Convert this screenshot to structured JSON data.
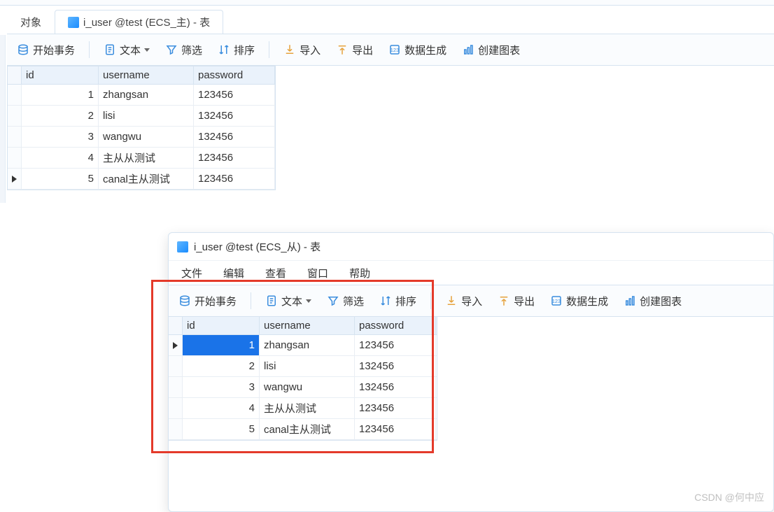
{
  "tabs": {
    "obj_label": "对象",
    "main_label": "i_user @test (ECS_主) - 表"
  },
  "toolbar": {
    "begin_tx": "开始事务",
    "text": "文本",
    "filter": "筛选",
    "sort": "排序",
    "import": "导入",
    "export": "导出",
    "data_gen": "数据生成",
    "chart": "创建图表"
  },
  "grid": {
    "headers": {
      "id": "id",
      "username": "username",
      "password": "password"
    },
    "rows": [
      {
        "id": "1",
        "username": "zhangsan",
        "password": "123456"
      },
      {
        "id": "2",
        "username": "lisi",
        "password": "132456"
      },
      {
        "id": "3",
        "username": "wangwu",
        "password": "132456"
      },
      {
        "id": "4",
        "username": "主从从测试",
        "password": "123456"
      },
      {
        "id": "5",
        "username": "canal主从测试",
        "password": "123456"
      }
    ],
    "cursor_row": 4
  },
  "win2": {
    "title": "i_user @test (ECS_从) - 表",
    "menu": {
      "file": "文件",
      "edit": "编辑",
      "view": "查看",
      "window": "窗口",
      "help": "帮助"
    },
    "cursor_row": 0,
    "selected_cell": {
      "row": 0,
      "col": "id"
    }
  },
  "watermark": "CSDN @何中应"
}
